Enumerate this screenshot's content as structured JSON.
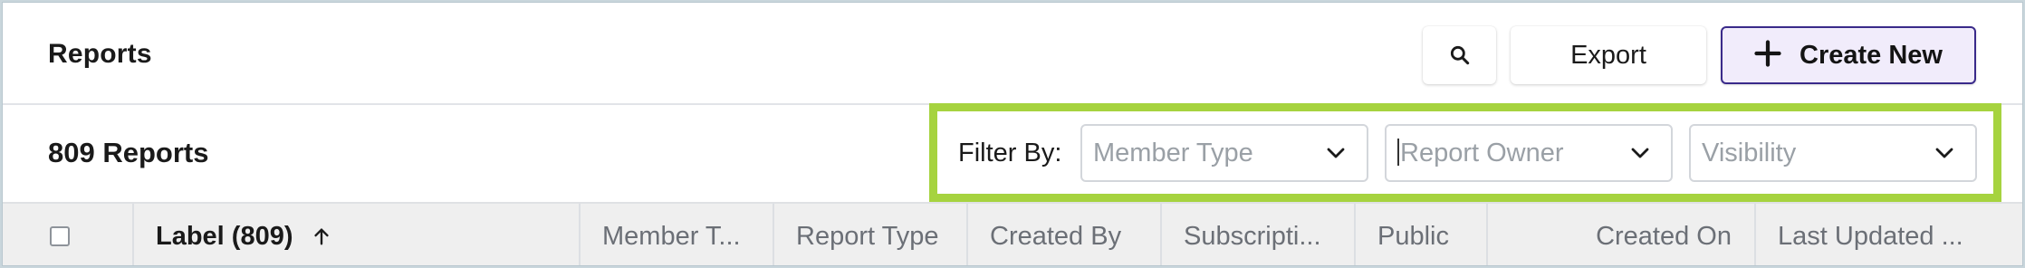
{
  "header": {
    "title": "Reports",
    "export_label": "Export",
    "create_label": "Create New"
  },
  "filters": {
    "count_title": "809 Reports",
    "label": "Filter By:",
    "member_type_placeholder": "Member Type",
    "report_owner_placeholder": "Report Owner",
    "visibility_placeholder": "Visibility",
    "highlight_color": "#a6d33f"
  },
  "table": {
    "columns": [
      "Label (809)",
      "Member T...",
      "Report Type",
      "Created By",
      "Subscripti...",
      "Public",
      "Created On",
      "Last Updated ..."
    ]
  },
  "icons": {
    "search": "search-icon",
    "plus": "plus-icon",
    "chevron": "chevron-down-icon",
    "sort": "arrow-up-icon"
  },
  "colors": {
    "create_bg": "#f1ecfb",
    "create_border": "#3a2a8a",
    "header_bg": "#efefef"
  }
}
